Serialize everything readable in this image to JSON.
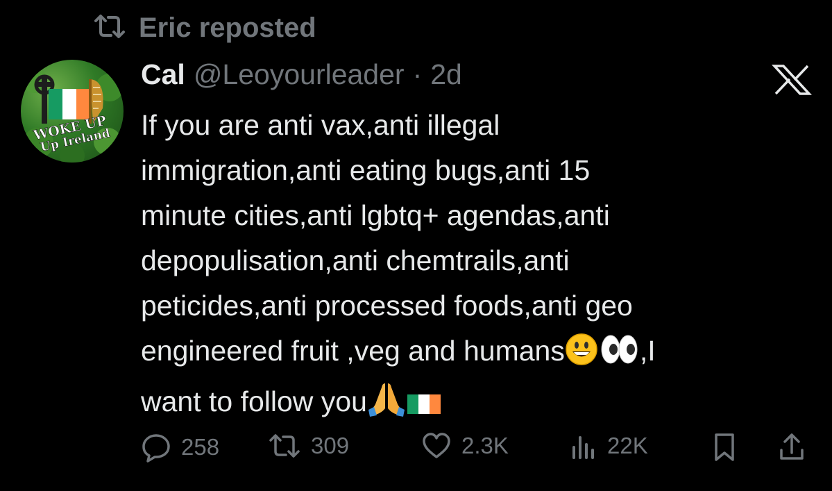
{
  "repost": {
    "icon": "repost-icon",
    "label": "Eric reposted"
  },
  "post": {
    "author_name": "Cal",
    "author_handle": "@Leoyourleader",
    "separator": "·",
    "time": "2d",
    "avatar_text_1": "WOKE UP",
    "avatar_text_2": "Up Ireland",
    "lines": [
      "If you are anti vax,anti illegal",
      "immigration,anti eating bugs,anti 15",
      "minute cities,anti lgbtq+ agendas,anti",
      "depopulisation,anti chemtrails,anti",
      "peticides,anti processed foods,anti geo",
      "engineered fruit ,veg and humans",
      ",I",
      "want to follow you"
    ],
    "emojis": [
      "smiley-emoji",
      "eyes-emoji",
      "praying-hands-emoji",
      "ireland-flag-emoji"
    ]
  },
  "platform_logo": "x-logo-icon",
  "actions": {
    "replies": "258",
    "reposts": "309",
    "likes": "2.3K",
    "views": "22K"
  },
  "colors": {
    "background": "#000000",
    "text": "#e7e9ea",
    "muted": "#71767b"
  }
}
